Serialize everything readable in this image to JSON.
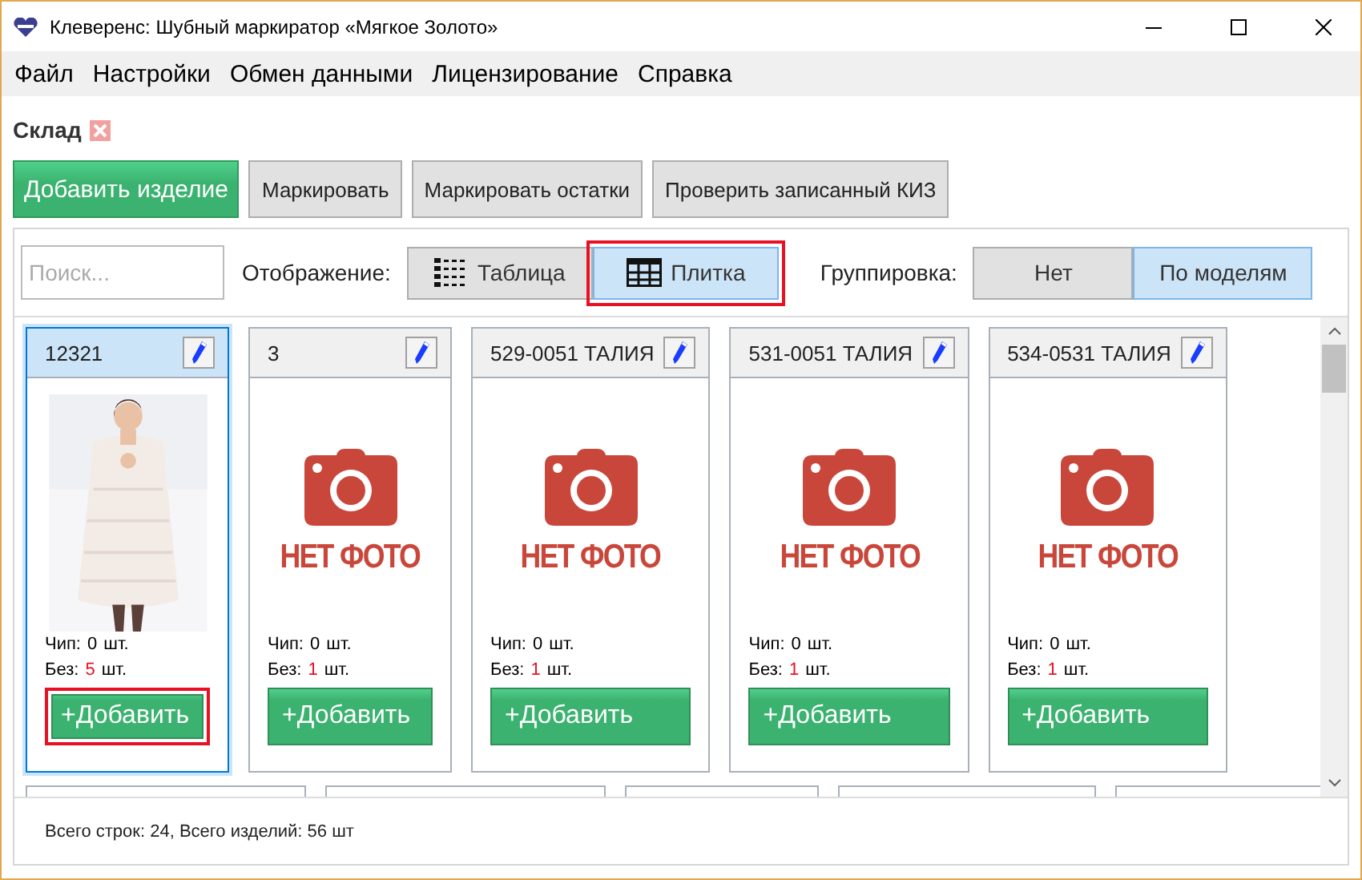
{
  "window": {
    "title": "Клеверенс: Шубный маркиратор «Мягкое Золото»"
  },
  "menu": [
    "Файл",
    "Настройки",
    "Обмен данными",
    "Лицензирование",
    "Справка"
  ],
  "section": {
    "title": "Склад"
  },
  "toolbar": [
    {
      "label": "Добавить изделие",
      "kind": "primary"
    },
    {
      "label": "Маркировать",
      "kind": "default"
    },
    {
      "label": "Маркировать остатки",
      "kind": "default"
    },
    {
      "label": "Проверить записанный КИЗ",
      "kind": "default"
    }
  ],
  "filter": {
    "search": {
      "placeholder": "Поиск..."
    },
    "display_label": "Отображение:",
    "display_options": [
      {
        "label": "Таблица",
        "selected": false,
        "highlighted": false
      },
      {
        "label": "Плитка",
        "selected": true,
        "highlighted": true
      }
    ],
    "grouping_label": "Группировка:",
    "grouping_options": [
      {
        "label": "Нет",
        "selected": false
      },
      {
        "label": "По моделям",
        "selected": true
      }
    ]
  },
  "tiles": [
    {
      "title": "12321",
      "selected": true,
      "chip_label": "Чип:",
      "chip_count": "0",
      "chip_unit": "шт.",
      "without_label": "Без:",
      "without_count": "5",
      "without_unit": "шт.",
      "add_button": "+Добавить",
      "button_highlighted": true
    },
    {
      "title": "3",
      "kind": "no_photo",
      "no_photo_text": "НЕТ ФОТО",
      "selected": false,
      "chip_label": "Чип:",
      "chip_count": "0",
      "chip_unit": "шт.",
      "without_label": "Без:",
      "without_count": "1",
      "without_unit": "шт.",
      "add_button": "+Добавить",
      "button_highlighted": false
    },
    {
      "title": "529-0051 ТАЛИЯ",
      "kind": "no_photo",
      "no_photo_text": "НЕТ ФОТО",
      "selected": false,
      "chip_label": "Чип:",
      "chip_count": "0",
      "chip_unit": "шт.",
      "without_label": "Без:",
      "without_count": "1",
      "without_unit": "шт.",
      "add_button": "+Добавить",
      "button_highlighted": false
    },
    {
      "title": "531-0051 ТАЛИЯ",
      "kind": "no_photo",
      "no_photo_text": "НЕТ ФОТО",
      "selected": false,
      "chip_label": "Чип:",
      "chip_count": "0",
      "chip_unit": "шт.",
      "without_label": "Без:",
      "without_count": "1",
      "without_unit": "шт.",
      "add_button": "+Добавить",
      "button_highlighted": false
    },
    {
      "title": "534-0531 ТАЛИЯ",
      "kind": "no_photo",
      "no_photo_text": "НЕТ ФОТО",
      "selected": false,
      "chip_label": "Чип:",
      "chip_count": "0",
      "chip_unit": "шт.",
      "without_label": "Без:",
      "without_count": "1",
      "without_unit": "шт.",
      "add_button": "+Добавить",
      "button_highlighted": false
    }
  ],
  "status_bar": "Всего строк: 24, Всего изделий: 56 шт"
}
